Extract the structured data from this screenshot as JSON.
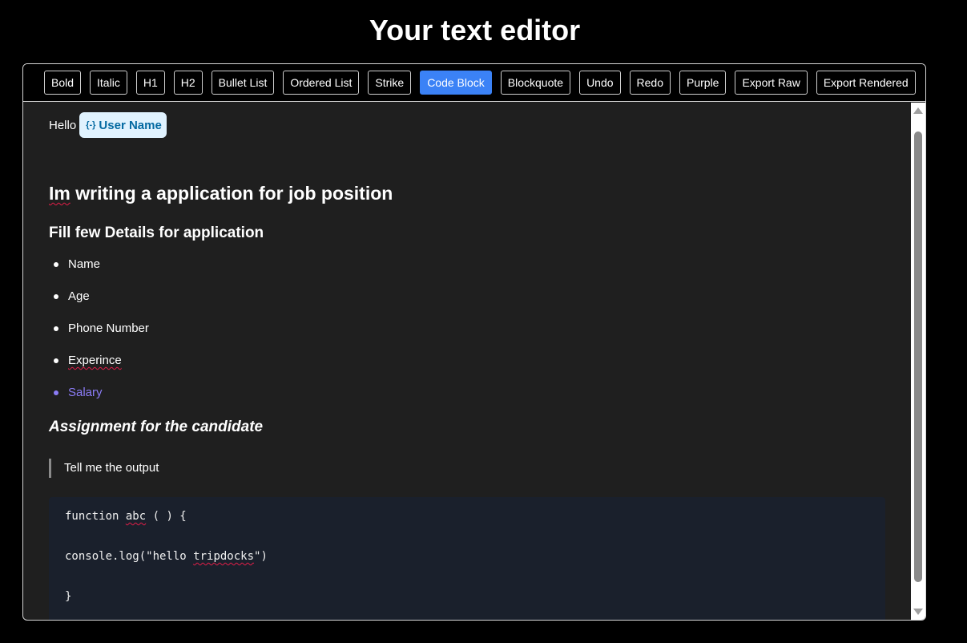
{
  "page": {
    "title": "Your text editor"
  },
  "toolbar": {
    "buttons": [
      {
        "label": "Bold",
        "active": false
      },
      {
        "label": "Italic",
        "active": false
      },
      {
        "label": "H1",
        "active": false
      },
      {
        "label": "H2",
        "active": false
      },
      {
        "label": "Bullet List",
        "active": false
      },
      {
        "label": "Ordered List",
        "active": false
      },
      {
        "label": "Strike",
        "active": false
      },
      {
        "label": "Code Block",
        "active": true
      },
      {
        "label": "Blockquote",
        "active": false
      },
      {
        "label": "Undo",
        "active": false
      },
      {
        "label": "Redo",
        "active": false
      },
      {
        "label": "Purple",
        "active": false
      },
      {
        "label": "Export Raw",
        "active": false
      },
      {
        "label": "Export Rendered",
        "active": false
      }
    ]
  },
  "document": {
    "greeting": "Hello",
    "mention": {
      "icon": "{-}",
      "label": "User Name"
    },
    "heading1": {
      "misspelled_word": "Im",
      "rest": " writing a application for job position"
    },
    "heading2": "Fill few Details for application",
    "bullets": [
      {
        "text": "Name"
      },
      {
        "text": "Age"
      },
      {
        "text": "Phone Number"
      },
      {
        "text": "Experince"
      },
      {
        "text": "Salary"
      }
    ],
    "heading3": "Assignment for the candidate",
    "blockquote": "Tell me the output",
    "code": {
      "line1_a": "function ",
      "line1_b": "abc",
      "line1_c": " ( ) {",
      "line2_a": "console.log(\"hello ",
      "line2_b": "tripdocks",
      "line2_c": "\")",
      "line3": "}"
    }
  },
  "colors": {
    "background": "#000000",
    "editor_background": "#1f1f1f",
    "active_button": "#3b82f6",
    "mention_background": "#e0f2fe",
    "mention_text": "#0369a1",
    "purple_text": "#8b7cf6",
    "code_background": "#1a202c"
  }
}
